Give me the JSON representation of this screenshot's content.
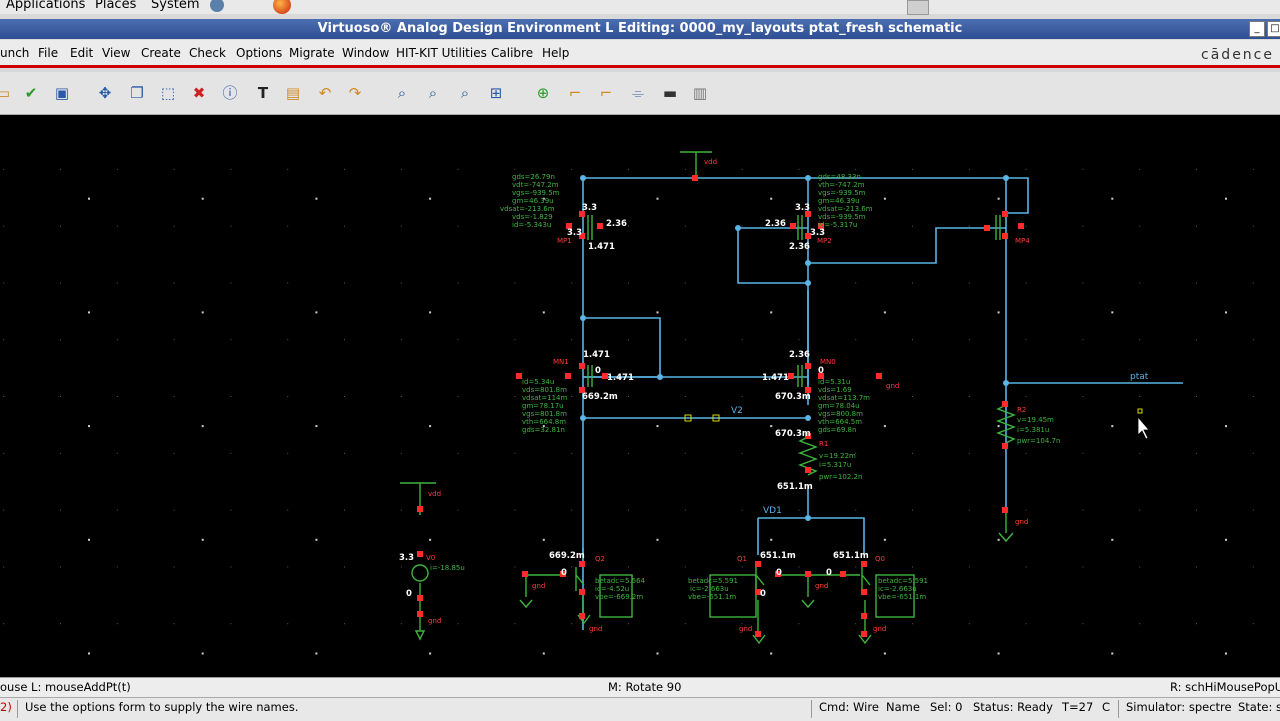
{
  "topbar": {
    "applications": "Applications",
    "places": "Places",
    "system": "System"
  },
  "window": {
    "title": "Virtuoso® Analog Design Environment L Editing: 0000_my_layouts ptat_fresh schematic"
  },
  "menu": [
    "unch",
    "File",
    "Edit",
    "View",
    "Create",
    "Check",
    "Options",
    "Migrate",
    "Window",
    "HIT-KIT Utilities",
    "Calibre",
    "Help"
  ],
  "brand": "cādence",
  "toolbar_icons": [
    "open-icon",
    "check-save-icon",
    "save-icon",
    "move-icon",
    "copy-icon",
    "stretch-icon",
    "delete-icon",
    "properties-icon",
    "text-icon",
    "label-icon",
    "undo-icon",
    "redo-icon",
    "zoom-fit-icon",
    "zoom-in-icon",
    "zoom-out-icon",
    "pan-icon",
    "add-instance-icon",
    "wire-icon",
    "wire-wide-icon",
    "pin-icon",
    "probe-icon",
    "notes-icon"
  ],
  "schematic": {
    "labels": {
      "vdd_top": "vdd",
      "vdd_src": "vdd",
      "gnd": "gnd",
      "ptat": "ptat",
      "v2": "V2",
      "vd1": "VD1",
      "v_src_value": "3.3",
      "v_src_current": "i=-18.85u",
      "v_src_zero": "0",
      "mp1": "MP1",
      "mp2": "MP2",
      "mp4": "MP4",
      "mn1": "MN1",
      "mn0": "MN0",
      "r1": "R1",
      "r2": "R2",
      "q2": "Q2",
      "q1": "Q1",
      "q0": "Q0",
      "v0": "V0",
      "n_3_3a": "3.3",
      "n_3_3b": "3.3",
      "n_3_3c": "3.3",
      "n_3_3d": "3.3",
      "n_2_36a": "2.36",
      "n_2_36b": "2.36",
      "n_2_36c": "2.36",
      "n_2_36d": "2.36",
      "n_1_471a": "1.471",
      "n_1_471b": "1.471",
      "n_1_471c": "1.471",
      "n_1_471d": "1.471",
      "n_669": "669.2m",
      "n_670a": "670.3m",
      "n_670b": "670.3m",
      "n_651a": "651.1m",
      "n_669b": "669.2m",
      "n_651b": "651.1m",
      "n_651c": "651.1m",
      "zero1": "0",
      "zero2": "0",
      "zero3": "0",
      "zero4": "0",
      "zero5": "0",
      "zero6": "0",
      "r1_params": [
        "v=19.22m",
        "i=5.317u",
        "pwr=102.2n"
      ],
      "r2_params": [
        "v=19.45m",
        "i=5.381u",
        "pwr=104.7n"
      ],
      "mp1_params": [
        "gds=26.79n",
        "vdt=-747.2m",
        "vgs=-939.5m",
        "gm=46.39u",
        "vdsat=-213.6m",
        "vds=-1.829",
        "id=-5.343u"
      ],
      "mp2_params": [
        "gds=48.33n",
        "vth=-747.2m",
        "vgs=-939.5m",
        "gm=46.39u",
        "vdsat=-213.6m",
        "vds=-939.5m",
        "id=-5.317u"
      ],
      "mn1_params": [
        "id=5.34u",
        "vds=801.8m",
        "vdsat=114m",
        "gm=78.17u",
        "vgs=801.8m",
        "vth=664.8m",
        "gds=32.81n"
      ],
      "mn0_params": [
        "id=5.31u",
        "vds=1.69",
        "vdsat=113.7m",
        "gm=78.04u",
        "vgs=800.8m",
        "vth=664.5m",
        "gds=69.8n"
      ],
      "q2_params": [
        "betadc=5.564",
        "ic=-4.52u",
        "vbe=-669.2m"
      ],
      "q1_params": [
        "betadc=5.591",
        "ic=-2.663u",
        "vbe=-651.1m"
      ],
      "q0_params": [
        "betadc=5.591",
        "ic=-2.663u",
        "vbe=-651.1m"
      ]
    }
  },
  "status_line": {
    "left": "ouse L: mouseAddPt(t)",
    "middle": "M: Rotate 90",
    "right": "R: schHiMousePopU"
  },
  "prompt": {
    "index": "2)",
    "message": "Use the options form to supply the wire names."
  },
  "status_bar": {
    "cmd": "Cmd: Wire",
    "name": "Name",
    "sel": "Sel: 0",
    "status": "Status: Ready",
    "temp": "T=27",
    "unit": "C",
    "simulator": "Simulator: spectre",
    "state": "State: s"
  }
}
